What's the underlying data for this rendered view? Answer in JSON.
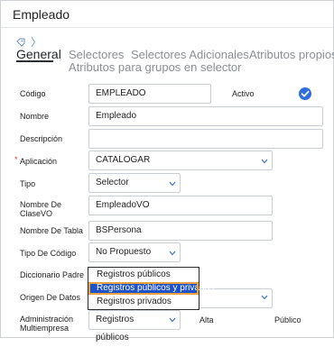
{
  "window": {
    "title": "Empleado"
  },
  "tabs": [
    {
      "label": "General"
    },
    {
      "label": "Selectores"
    },
    {
      "label": "Selectores Adicionales"
    },
    {
      "label": "Atributos propios"
    },
    {
      "label": "Atributos para grupos en selector"
    }
  ],
  "form": {
    "codigo": {
      "label": "Código",
      "value": "EMPLEADO"
    },
    "activo": {
      "label": "Activo",
      "checked": true
    },
    "nombre": {
      "label": "Nombre",
      "value": "Empleado"
    },
    "descripcion": {
      "label": "Descripción",
      "value": ""
    },
    "aplicacion": {
      "required_mark": "*",
      "label": "Aplicación",
      "value": "CATALOGAR"
    },
    "tipo": {
      "label": "Tipo",
      "value": "Selector"
    },
    "nombre_clasevo": {
      "label_line1": "Nombre De",
      "label_line2": "ClaseVO",
      "value": "EmpleadoVO"
    },
    "nombre_tabla": {
      "label": "Nombre De Tabla",
      "value": "BSPersona"
    },
    "tipo_codigo": {
      "label": "Tipo De Código",
      "value": "No Propuesto"
    },
    "diccionario_padre": {
      "label": "Diccionario Padre"
    },
    "origen_datos": {
      "label": "Origen De Datos"
    },
    "administracion": {
      "label_line1": "Administración",
      "label_line2": "Multiempresa",
      "value": "Registros públicos",
      "extra1": "Alta",
      "extra2": "Público"
    }
  },
  "dropdown": {
    "options": [
      {
        "label": "Registros públicos",
        "highlighted": false
      },
      {
        "label": "Registros públicos y privados",
        "highlighted": true
      },
      {
        "label": "Registros privados",
        "highlighted": false
      }
    ]
  },
  "colors": {
    "accent": "#2f6fdc",
    "highlight": "#1f52c8",
    "focus_outline": "#e8a341",
    "required": "#d0393e"
  }
}
